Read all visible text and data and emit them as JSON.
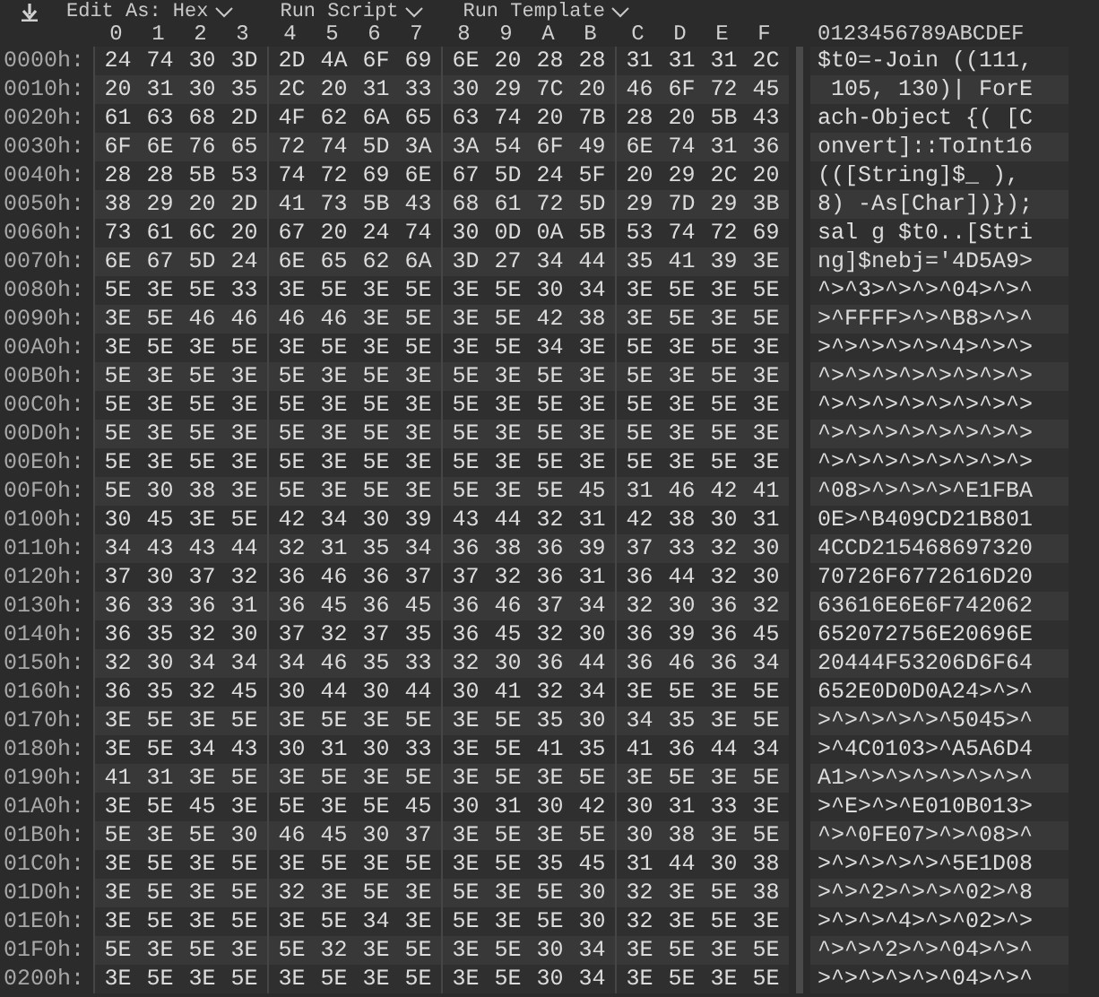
{
  "toolbar": {
    "menus": [
      {
        "label": "Edit As: Hex"
      },
      {
        "label": "Run Script"
      },
      {
        "label": "Run Template"
      }
    ]
  },
  "header": {
    "columns": [
      "0",
      "1",
      "2",
      "3",
      "4",
      "5",
      "6",
      "7",
      "8",
      "9",
      "A",
      "B",
      "C",
      "D",
      "E",
      "F"
    ],
    "ascii": "0123456789ABCDEF"
  },
  "rows": [
    {
      "offset": "0000h:",
      "bytes": [
        "24",
        "74",
        "30",
        "3D",
        "2D",
        "4A",
        "6F",
        "69",
        "6E",
        "20",
        "28",
        "28",
        "31",
        "31",
        "31",
        "2C"
      ],
      "ascii": "$t0=-Join ((111,"
    },
    {
      "offset": "0010h:",
      "bytes": [
        "20",
        "31",
        "30",
        "35",
        "2C",
        "20",
        "31",
        "33",
        "30",
        "29",
        "7C",
        "20",
        "46",
        "6F",
        "72",
        "45"
      ],
      "ascii": " 105, 130)| ForE"
    },
    {
      "offset": "0020h:",
      "bytes": [
        "61",
        "63",
        "68",
        "2D",
        "4F",
        "62",
        "6A",
        "65",
        "63",
        "74",
        "20",
        "7B",
        "28",
        "20",
        "5B",
        "43"
      ],
      "ascii": "ach-Object {( [C"
    },
    {
      "offset": "0030h:",
      "bytes": [
        "6F",
        "6E",
        "76",
        "65",
        "72",
        "74",
        "5D",
        "3A",
        "3A",
        "54",
        "6F",
        "49",
        "6E",
        "74",
        "31",
        "36"
      ],
      "ascii": "onvert]::ToInt16"
    },
    {
      "offset": "0040h:",
      "bytes": [
        "28",
        "28",
        "5B",
        "53",
        "74",
        "72",
        "69",
        "6E",
        "67",
        "5D",
        "24",
        "5F",
        "20",
        "29",
        "2C",
        "20"
      ],
      "ascii": "(([String]$_ ), "
    },
    {
      "offset": "0050h:",
      "bytes": [
        "38",
        "29",
        "20",
        "2D",
        "41",
        "73",
        "5B",
        "43",
        "68",
        "61",
        "72",
        "5D",
        "29",
        "7D",
        "29",
        "3B"
      ],
      "ascii": "8) -As[Char])});"
    },
    {
      "offset": "0060h:",
      "bytes": [
        "73",
        "61",
        "6C",
        "20",
        "67",
        "20",
        "24",
        "74",
        "30",
        "0D",
        "0A",
        "5B",
        "53",
        "74",
        "72",
        "69"
      ],
      "ascii": "sal g $t0..[Stri"
    },
    {
      "offset": "0070h:",
      "bytes": [
        "6E",
        "67",
        "5D",
        "24",
        "6E",
        "65",
        "62",
        "6A",
        "3D",
        "27",
        "34",
        "44",
        "35",
        "41",
        "39",
        "3E"
      ],
      "ascii": "ng]$nebj='4D5A9>"
    },
    {
      "offset": "0080h:",
      "bytes": [
        "5E",
        "3E",
        "5E",
        "33",
        "3E",
        "5E",
        "3E",
        "5E",
        "3E",
        "5E",
        "30",
        "34",
        "3E",
        "5E",
        "3E",
        "5E"
      ],
      "ascii": "^>^3>^>^>^04>^>^"
    },
    {
      "offset": "0090h:",
      "bytes": [
        "3E",
        "5E",
        "46",
        "46",
        "46",
        "46",
        "3E",
        "5E",
        "3E",
        "5E",
        "42",
        "38",
        "3E",
        "5E",
        "3E",
        "5E"
      ],
      "ascii": ">^FFFF>^>^B8>^>^"
    },
    {
      "offset": "00A0h:",
      "bytes": [
        "3E",
        "5E",
        "3E",
        "5E",
        "3E",
        "5E",
        "3E",
        "5E",
        "3E",
        "5E",
        "34",
        "3E",
        "5E",
        "3E",
        "5E",
        "3E"
      ],
      "ascii": ">^>^>^>^>^4>^>^>"
    },
    {
      "offset": "00B0h:",
      "bytes": [
        "5E",
        "3E",
        "5E",
        "3E",
        "5E",
        "3E",
        "5E",
        "3E",
        "5E",
        "3E",
        "5E",
        "3E",
        "5E",
        "3E",
        "5E",
        "3E"
      ],
      "ascii": "^>^>^>^>^>^>^>^>"
    },
    {
      "offset": "00C0h:",
      "bytes": [
        "5E",
        "3E",
        "5E",
        "3E",
        "5E",
        "3E",
        "5E",
        "3E",
        "5E",
        "3E",
        "5E",
        "3E",
        "5E",
        "3E",
        "5E",
        "3E"
      ],
      "ascii": "^>^>^>^>^>^>^>^>"
    },
    {
      "offset": "00D0h:",
      "bytes": [
        "5E",
        "3E",
        "5E",
        "3E",
        "5E",
        "3E",
        "5E",
        "3E",
        "5E",
        "3E",
        "5E",
        "3E",
        "5E",
        "3E",
        "5E",
        "3E"
      ],
      "ascii": "^>^>^>^>^>^>^>^>"
    },
    {
      "offset": "00E0h:",
      "bytes": [
        "5E",
        "3E",
        "5E",
        "3E",
        "5E",
        "3E",
        "5E",
        "3E",
        "5E",
        "3E",
        "5E",
        "3E",
        "5E",
        "3E",
        "5E",
        "3E"
      ],
      "ascii": "^>^>^>^>^>^>^>^>"
    },
    {
      "offset": "00F0h:",
      "bytes": [
        "5E",
        "30",
        "38",
        "3E",
        "5E",
        "3E",
        "5E",
        "3E",
        "5E",
        "3E",
        "5E",
        "45",
        "31",
        "46",
        "42",
        "41"
      ],
      "ascii": "^08>^>^>^>^E1FBA"
    },
    {
      "offset": "0100h:",
      "bytes": [
        "30",
        "45",
        "3E",
        "5E",
        "42",
        "34",
        "30",
        "39",
        "43",
        "44",
        "32",
        "31",
        "42",
        "38",
        "30",
        "31"
      ],
      "ascii": "0E>^B409CD21B801"
    },
    {
      "offset": "0110h:",
      "bytes": [
        "34",
        "43",
        "43",
        "44",
        "32",
        "31",
        "35",
        "34",
        "36",
        "38",
        "36",
        "39",
        "37",
        "33",
        "32",
        "30"
      ],
      "ascii": "4CCD215468697320"
    },
    {
      "offset": "0120h:",
      "bytes": [
        "37",
        "30",
        "37",
        "32",
        "36",
        "46",
        "36",
        "37",
        "37",
        "32",
        "36",
        "31",
        "36",
        "44",
        "32",
        "30"
      ],
      "ascii": "70726F6772616D20"
    },
    {
      "offset": "0130h:",
      "bytes": [
        "36",
        "33",
        "36",
        "31",
        "36",
        "45",
        "36",
        "45",
        "36",
        "46",
        "37",
        "34",
        "32",
        "30",
        "36",
        "32"
      ],
      "ascii": "63616E6E6F742062"
    },
    {
      "offset": "0140h:",
      "bytes": [
        "36",
        "35",
        "32",
        "30",
        "37",
        "32",
        "37",
        "35",
        "36",
        "45",
        "32",
        "30",
        "36",
        "39",
        "36",
        "45"
      ],
      "ascii": "652072756E20696E"
    },
    {
      "offset": "0150h:",
      "bytes": [
        "32",
        "30",
        "34",
        "34",
        "34",
        "46",
        "35",
        "33",
        "32",
        "30",
        "36",
        "44",
        "36",
        "46",
        "36",
        "34"
      ],
      "ascii": "20444F53206D6F64"
    },
    {
      "offset": "0160h:",
      "bytes": [
        "36",
        "35",
        "32",
        "45",
        "30",
        "44",
        "30",
        "44",
        "30",
        "41",
        "32",
        "34",
        "3E",
        "5E",
        "3E",
        "5E"
      ],
      "ascii": "652E0D0D0A24>^>^"
    },
    {
      "offset": "0170h:",
      "bytes": [
        "3E",
        "5E",
        "3E",
        "5E",
        "3E",
        "5E",
        "3E",
        "5E",
        "3E",
        "5E",
        "35",
        "30",
        "34",
        "35",
        "3E",
        "5E"
      ],
      "ascii": ">^>^>^>^>^5045>^"
    },
    {
      "offset": "0180h:",
      "bytes": [
        "3E",
        "5E",
        "34",
        "43",
        "30",
        "31",
        "30",
        "33",
        "3E",
        "5E",
        "41",
        "35",
        "41",
        "36",
        "44",
        "34"
      ],
      "ascii": ">^4C0103>^A5A6D4"
    },
    {
      "offset": "0190h:",
      "bytes": [
        "41",
        "31",
        "3E",
        "5E",
        "3E",
        "5E",
        "3E",
        "5E",
        "3E",
        "5E",
        "3E",
        "5E",
        "3E",
        "5E",
        "3E",
        "5E"
      ],
      "ascii": "A1>^>^>^>^>^>^>^"
    },
    {
      "offset": "01A0h:",
      "bytes": [
        "3E",
        "5E",
        "45",
        "3E",
        "5E",
        "3E",
        "5E",
        "45",
        "30",
        "31",
        "30",
        "42",
        "30",
        "31",
        "33",
        "3E"
      ],
      "ascii": ">^E>^>^E010B013>"
    },
    {
      "offset": "01B0h:",
      "bytes": [
        "5E",
        "3E",
        "5E",
        "30",
        "46",
        "45",
        "30",
        "37",
        "3E",
        "5E",
        "3E",
        "5E",
        "30",
        "38",
        "3E",
        "5E"
      ],
      "ascii": "^>^0FE07>^>^08>^"
    },
    {
      "offset": "01C0h:",
      "bytes": [
        "3E",
        "5E",
        "3E",
        "5E",
        "3E",
        "5E",
        "3E",
        "5E",
        "3E",
        "5E",
        "35",
        "45",
        "31",
        "44",
        "30",
        "38"
      ],
      "ascii": ">^>^>^>^>^5E1D08"
    },
    {
      "offset": "01D0h:",
      "bytes": [
        "3E",
        "5E",
        "3E",
        "5E",
        "32",
        "3E",
        "5E",
        "3E",
        "5E",
        "3E",
        "5E",
        "30",
        "32",
        "3E",
        "5E",
        "38"
      ],
      "ascii": ">^>^2>^>^>^02>^8"
    },
    {
      "offset": "01E0h:",
      "bytes": [
        "3E",
        "5E",
        "3E",
        "5E",
        "3E",
        "5E",
        "34",
        "3E",
        "5E",
        "3E",
        "5E",
        "30",
        "32",
        "3E",
        "5E",
        "3E"
      ],
      "ascii": ">^>^>^4>^>^02>^>"
    },
    {
      "offset": "01F0h:",
      "bytes": [
        "5E",
        "3E",
        "5E",
        "3E",
        "5E",
        "32",
        "3E",
        "5E",
        "3E",
        "5E",
        "30",
        "34",
        "3E",
        "5E",
        "3E",
        "5E"
      ],
      "ascii": "^>^>^2>^>^04>^>^"
    },
    {
      "offset": "0200h:",
      "bytes": [
        "3E",
        "5E",
        "3E",
        "5E",
        "3E",
        "5E",
        "3E",
        "5E",
        "3E",
        "5E",
        "30",
        "34",
        "3E",
        "5E",
        "3E",
        "5E"
      ],
      "ascii": ">^>^>^>^>^04>^>^"
    }
  ]
}
